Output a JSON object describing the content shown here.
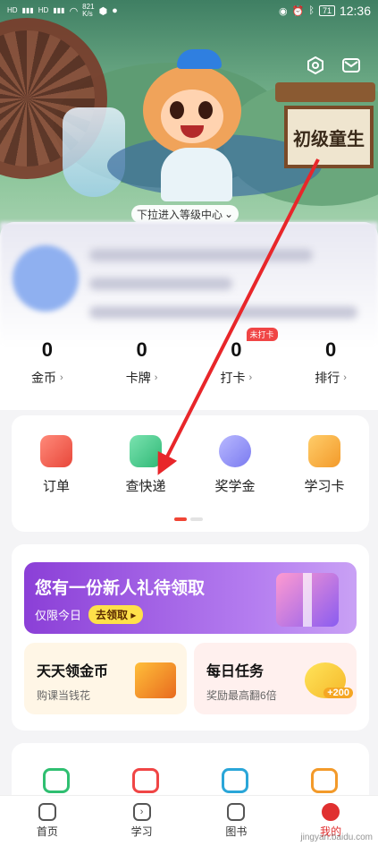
{
  "status_bar": {
    "left_small_1": "HD",
    "left_small_2": "HD",
    "net_speed": "821\nK/s",
    "battery": "71",
    "time": "12:36"
  },
  "hero": {
    "sign_text": "初级童生",
    "pull_hint": "下拉进入等级中心",
    "settings_icon": "hexagon-settings-icon",
    "message_icon": "mail-icon"
  },
  "stats": [
    {
      "value": "0",
      "label": "金币"
    },
    {
      "value": "0",
      "label": "卡牌"
    },
    {
      "value": "0",
      "label": "打卡",
      "badge": "未打卡"
    },
    {
      "value": "0",
      "label": "排行"
    }
  ],
  "quick_menu": [
    {
      "label": "订单",
      "icon": "order-icon",
      "color": "#f26a5a"
    },
    {
      "label": "查快递",
      "icon": "express-icon",
      "color": "#3fcf8a"
    },
    {
      "label": "奖学金",
      "icon": "scholarship-icon",
      "color": "#8c8cf5"
    },
    {
      "label": "学习卡",
      "icon": "study-card-icon",
      "color": "#f6a33a"
    }
  ],
  "promo": {
    "banner_title": "您有一份新人礼待领取",
    "banner_sub": "仅限今日",
    "banner_button": "去领取",
    "task1_title": "天天领金币",
    "task1_sub": "购课当钱花",
    "task2_title": "每日任务",
    "task2_sub": "奖励最高翻6倍",
    "task2_badge": "+200"
  },
  "bottom_nav": [
    {
      "label": "首页",
      "icon": "home-icon",
      "glyph": ""
    },
    {
      "label": "学习",
      "icon": "study-icon",
      "glyph": "›"
    },
    {
      "label": "图书",
      "icon": "book-icon",
      "glyph": ""
    },
    {
      "label": "我的",
      "icon": "profile-icon",
      "glyph": ""
    }
  ],
  "watermark": "jingyan.baidu.com"
}
